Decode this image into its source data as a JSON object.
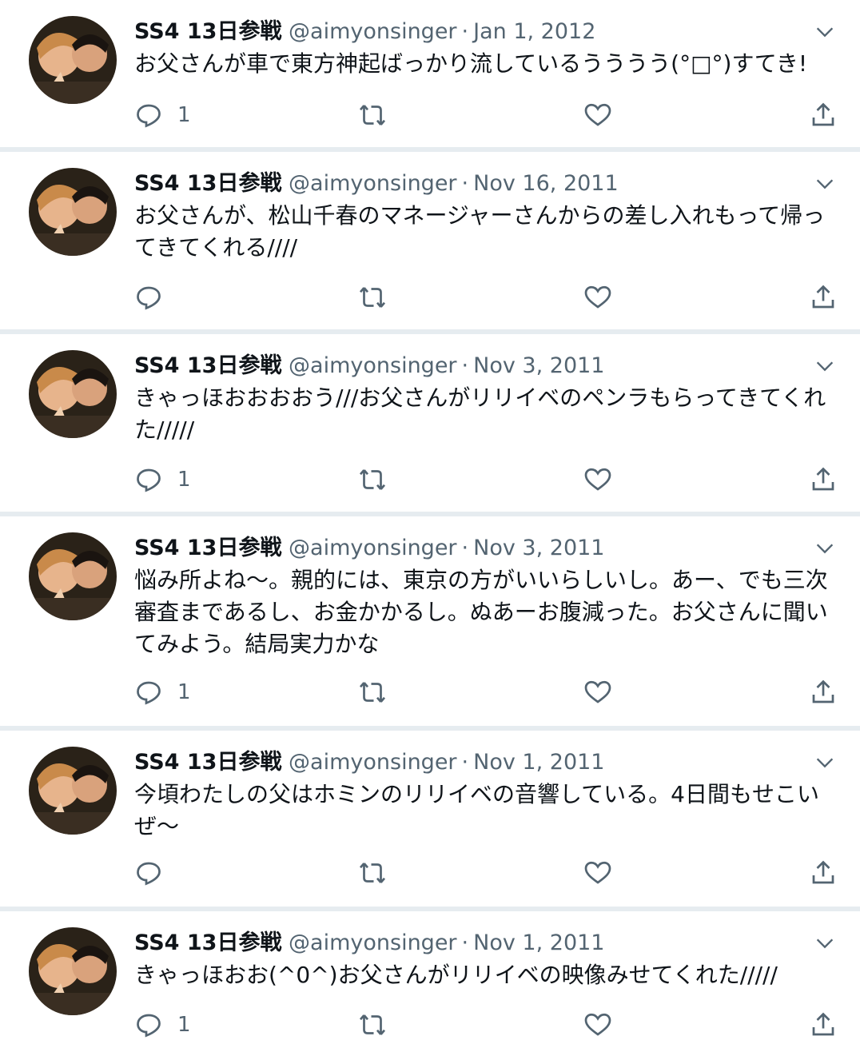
{
  "tweets": [
    {
      "name": "SS4 13日参戦",
      "handle": "@aimyonsinger",
      "sep": "·",
      "date": "Jan 1, 2012",
      "text": "お父さんが車で東方神起ばっかり流しているうううう(°□°)すてき!",
      "reply_count": "1"
    },
    {
      "name": "SS4 13日参戦",
      "handle": "@aimyonsinger",
      "sep": "·",
      "date": "Nov 16, 2011",
      "text": "お父さんが、松山千春のマネージャーさんからの差し入れもって帰ってきてくれる////",
      "reply_count": ""
    },
    {
      "name": "SS4 13日参戦",
      "handle": "@aimyonsinger",
      "sep": "·",
      "date": "Nov 3, 2011",
      "text": "きゃっほおおおおう///お父さんがリリイベのペンラもらってきてくれた/////",
      "reply_count": "1"
    },
    {
      "name": "SS4 13日参戦",
      "handle": "@aimyonsinger",
      "sep": "·",
      "date": "Nov 3, 2011",
      "text": "悩み所よね〜。親的には、東京の方がいいらしいし。あー、でも三次審査まであるし、お金かかるし。ぬあーお腹減った。お父さんに聞いてみよう。結局実力かな",
      "reply_count": "1"
    },
    {
      "name": "SS4 13日参戦",
      "handle": "@aimyonsinger",
      "sep": "·",
      "date": "Nov 1, 2011",
      "text": "今頃わたしの父はホミンのリリイベの音響している。4日間もせこいぜ〜",
      "reply_count": ""
    },
    {
      "name": "SS4 13日参戦",
      "handle": "@aimyonsinger",
      "sep": "·",
      "date": "Nov 1, 2011",
      "text": "きゃっほおお(^0^)お父さんがリリイベの映像みせてくれた/////",
      "reply_count": "1"
    }
  ],
  "icons": {
    "reply": "reply-icon",
    "retweet": "retweet-icon",
    "like": "like-icon",
    "share": "share-icon",
    "caret": "chevron-down-icon"
  },
  "colors": {
    "text": "#0f1419",
    "muted": "#536471",
    "divider": "#e6ecf0"
  }
}
